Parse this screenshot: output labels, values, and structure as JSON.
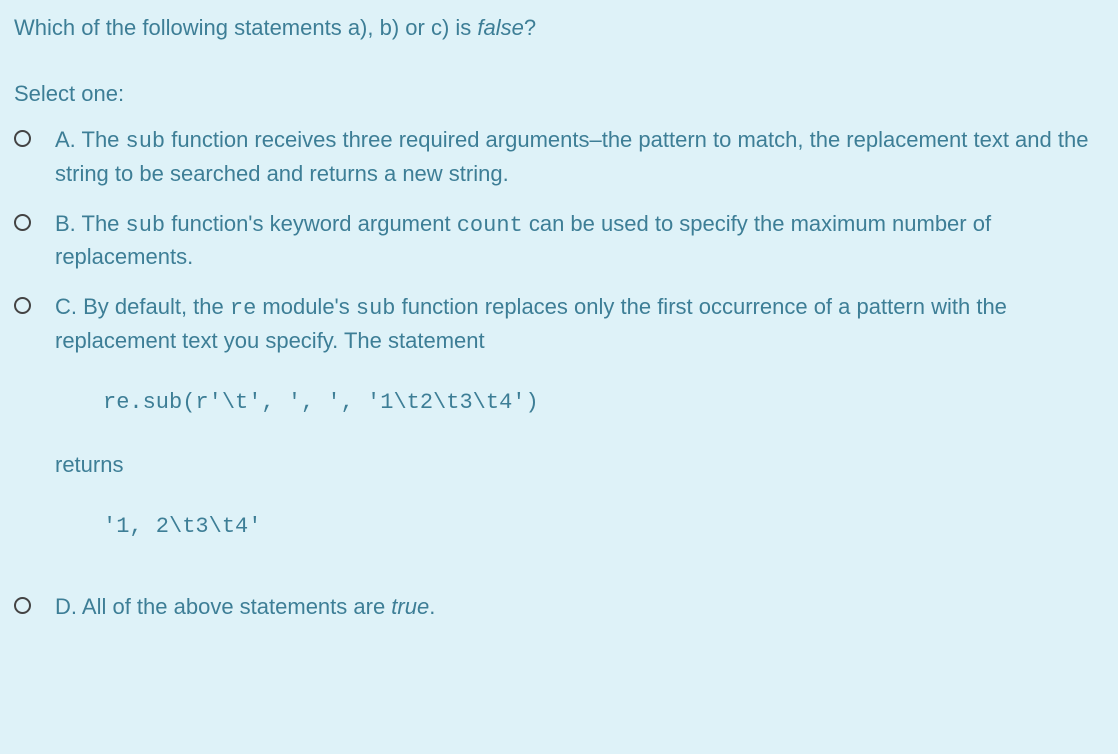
{
  "question": {
    "prefix": "Which of the following statements a), b) or c) is ",
    "emph": "false",
    "suffix": "?"
  },
  "select_label": "Select one:",
  "options": {
    "a": {
      "pre": "A. The ",
      "code1": "sub",
      "post": " function receives three required arguments–the pattern to match, the replacement text and the string to be searched and returns a new string."
    },
    "b": {
      "pre": "B. The ",
      "code1": "sub",
      "mid1": " function's keyword argument ",
      "code2": "count",
      "post": " can be used to specify the maximum number of replacements."
    },
    "c": {
      "pre": "C. By default, the ",
      "code1": "re",
      "mid1": " module's ",
      "code2": "sub",
      "post": " function replaces only the first occurrence of a pattern with the replacement text you specify. The statement",
      "code_block1": "re.sub(r'\\t', ', ', '1\\t2\\t3\\t4')",
      "returns": "returns",
      "code_block2": "'1, 2\\t3\\t4'"
    },
    "d": {
      "pre": "D. All of the above statements are ",
      "emph": "true",
      "post": "."
    }
  }
}
